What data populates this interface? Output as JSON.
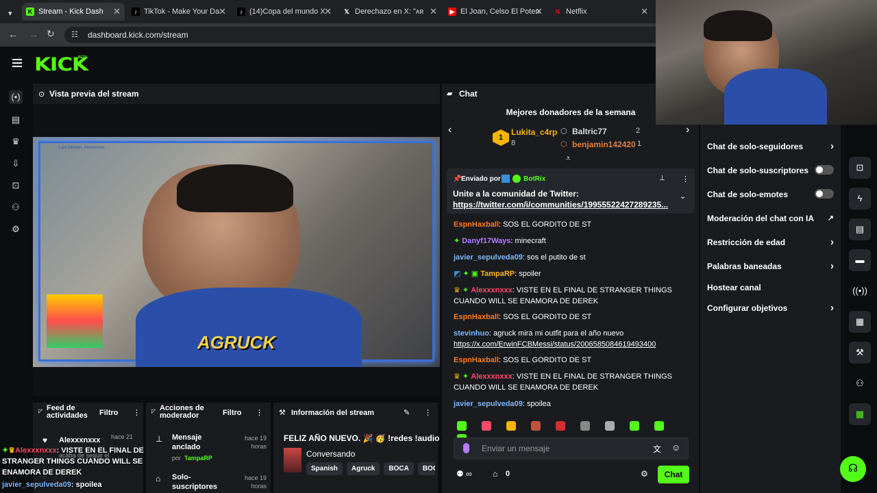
{
  "browser": {
    "tabs": [
      {
        "title": "Stream - Kick Dash",
        "icon": "kick-icon"
      },
      {
        "title": "TikTok - Make Your Da",
        "icon": "tiktok-icon"
      },
      {
        "title": "(14)Copa del mundo X",
        "icon": "tiktok-icon"
      },
      {
        "title": "Derechazo en X: \"ᴀʀ",
        "icon": "x-icon"
      },
      {
        "title": "El Joan, Celso El Poten",
        "icon": "youtube-icon"
      },
      {
        "title": "Netflix",
        "icon": "netflix-icon"
      }
    ],
    "url": "dashboard.kick.com/stream"
  },
  "kick": {
    "logo": "KICK",
    "beta": "BETA"
  },
  "preview": {
    "title": "Vista previa del stream"
  },
  "chat": {
    "title": "Chat",
    "donors_title": "Mejores donadores de la semana",
    "donors": [
      {
        "rank": "1",
        "name": "Lukita_c4rp",
        "amount": "8"
      },
      {
        "name": "Baltric77",
        "amount": "2"
      },
      {
        "name": "benjamin142420",
        "amount": "1"
      }
    ],
    "pinned": {
      "sent_by": "Enviado por",
      "user": "BotRix",
      "text": "Unite a la comunidad de Twitter:",
      "link": "https://twitter.com/i/communities/19955522427289235..."
    },
    "messages": [
      {
        "user": "EspnHaxball",
        "text": "SOS EL GORDITO DE ST",
        "color": "#ff7a1a"
      },
      {
        "user": "Danyf17Ways",
        "text": "minecraft",
        "color": "#b57cff"
      },
      {
        "user": "javier_sepulveda09",
        "text": "sos el putito de st",
        "color": "#7ab8ff"
      },
      {
        "user": "TampaRP",
        "text": "spoiler",
        "color": "#ffb21a"
      },
      {
        "user": "Alexxxnxxx",
        "text": "VISTE EN EL FINAL DE STRANGER THINGS CUANDO WILL SE ENAMORA DE DEREK",
        "color": "#ff4a6b"
      },
      {
        "user": "EspnHaxball",
        "text": "SOS EL GORDITO DE ST",
        "color": "#ff7a1a"
      },
      {
        "user": "stevinhuo",
        "text": "agruck mira mi outfit para el año nuevo",
        "link": "https://x.com/ErwinFCBMessi/status/2006585084619493400",
        "color": "#7ab8ff"
      },
      {
        "user": "EspnHaxball",
        "text": "SOS EL GORDITO DE ST",
        "color": "#ff7a1a"
      },
      {
        "user": "Alexxxnxxx",
        "text": "VISTE EN EL FINAL DE STRANGER THINGS CUANDO WILL SE ENAMORA DE DEREK",
        "color": "#ff4a6b"
      },
      {
        "user": "javier_sepulveda09",
        "text": "spoilea",
        "color": "#7ab8ff"
      }
    ],
    "input_placeholder": "Enviar un mensaje",
    "viewer_count": "0",
    "send_label": "Chat"
  },
  "settings": {
    "items": [
      {
        "label": "Chat de solo-seguidores",
        "control": "chevron"
      },
      {
        "label": "Chat de solo-suscriptores",
        "control": "toggle"
      },
      {
        "label": "Chat de solo-emotes",
        "control": "toggle"
      },
      {
        "label": "Moderación del chat con IA",
        "control": "external"
      },
      {
        "label": "Restricción de edad",
        "control": "chevron"
      },
      {
        "label": "Palabras baneadas",
        "control": "chevron"
      },
      {
        "label": "Hostear canal",
        "control": "none"
      },
      {
        "label": "Configurar objetivos",
        "control": "chevron"
      }
    ]
  },
  "activity": {
    "title": "Feed de actividades",
    "filter": "Filtro",
    "user": "Alexxxnxxx",
    "time": "hace 21 minutos",
    "follow": "acaba de seguir el"
  },
  "modactions": {
    "title": "Acciones de moderador",
    "filter": "Filtro",
    "items": [
      {
        "label": "Mensaje anclado",
        "by": "por",
        "user": "TampaRP",
        "time": "hace 19 horas"
      },
      {
        "label": "Solo-suscriptores",
        "time": "hace 19 horas"
      }
    ]
  },
  "streaminfo": {
    "title": "Información del stream",
    "stream_title": "FELIZ AÑO NUEVO. 🎉 🥳 !redes !audio",
    "category": "Conversando",
    "tags": [
      "Spanish",
      "Agruck",
      "BOCA",
      "BOC"
    ]
  },
  "overlay": {
    "line1_user": "Alexxxnxxx",
    "line1_text": ": VISTE EN EL FINAL DE STRANGER THINGS CUANDO WILL SE ENAMORA DE DEREK",
    "line2_user": "javier_sepulveda09",
    "line2_text": ": spoilea"
  },
  "video_overlay": {
    "logo": "AGRUCK",
    "last_follower": "Last follower: Alexxxnxxx"
  }
}
